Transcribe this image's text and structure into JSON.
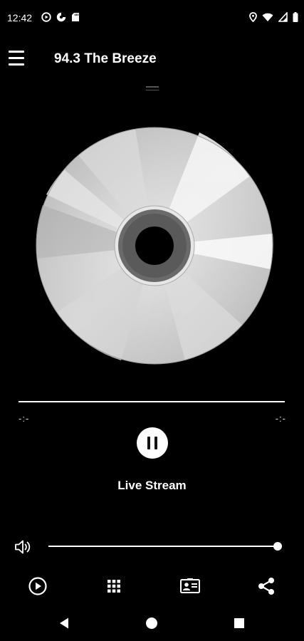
{
  "status_bar": {
    "time": "12:42",
    "left_icons": [
      "play-circle-icon",
      "data-saver-icon",
      "sd-card-icon"
    ],
    "right_icons": [
      "location-icon",
      "wifi-icon",
      "signal-icon",
      "battery-icon"
    ]
  },
  "app_bar": {
    "title": "94.3 The Breeze",
    "menu_icon": "menu-icon"
  },
  "player": {
    "artwork": "cd-disc-image",
    "elapsed": "-:-",
    "duration": "-:-",
    "progress": 1.0,
    "state_icon": "pause-icon",
    "track_title": "Live Stream"
  },
  "volume": {
    "icon": "volume-icon",
    "level": 1.0
  },
  "toolbar": {
    "items": [
      "play-circle-icon",
      "grid-icon",
      "contact-card-icon",
      "share-icon"
    ]
  },
  "navigation": {
    "items": [
      "back-icon",
      "home-icon",
      "recents-icon"
    ]
  },
  "colors": {
    "background": "#000000",
    "foreground": "#ffffff"
  }
}
